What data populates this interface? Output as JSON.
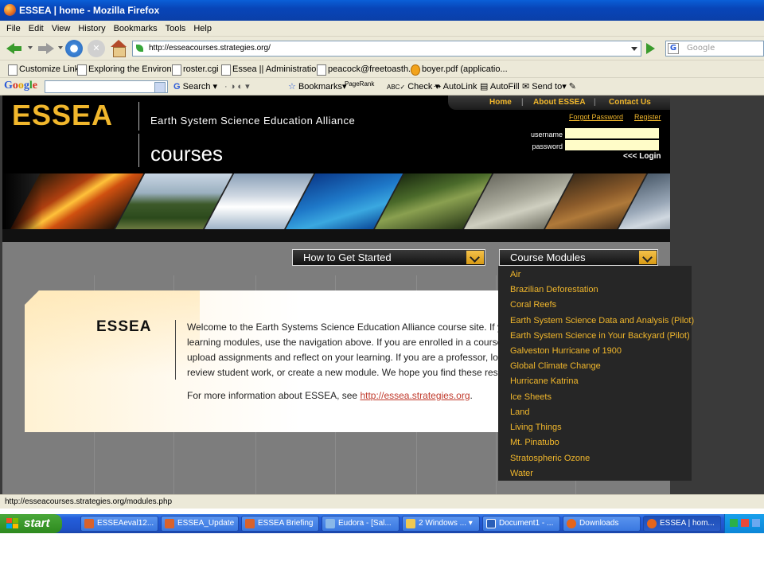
{
  "window": {
    "title": "ESSEA | home - Mozilla Firefox"
  },
  "menu": [
    "File",
    "Edit",
    "View",
    "History",
    "Bookmarks",
    "Tools",
    "Help"
  ],
  "nav": {
    "url": "http://esseacourses.strategies.org/",
    "search_placeholder": "Google",
    "search_engine_icon": "G"
  },
  "bookmarks": [
    "Customize Links",
    "Exploring the Environ...",
    "roster.cgi",
    "Essea || Administratio...",
    "peacock@freetoasth...",
    "boyer.pdf (applicatio..."
  ],
  "google_toolbar": {
    "logo_letters": [
      "G",
      "o",
      "o",
      "g",
      "l",
      "e"
    ],
    "search_label": "Search",
    "bookmarks_label": "Bookmarks",
    "pagerank_label": "PageRank",
    "check_label": "Check",
    "autolink_label": "AutoLink",
    "autofill_label": "AutoFill",
    "sendto_label": "Send to"
  },
  "site": {
    "logo": "ESSEA",
    "subtitle": "Earth System Science Education Alliance",
    "courses": "courses",
    "topnav": [
      "Home",
      "About ESSEA",
      "Contact Us"
    ],
    "topnav_sep": "|",
    "forgot": "Forgot Password",
    "register": "Register",
    "username_label": "username",
    "password_label": "password",
    "login": "<<< Login",
    "get_started": "How to Get Started",
    "course_modules": "Course Modules",
    "welcome_title": "ESSEA",
    "welcome_text": "Welcome to the Earth Systems Science Education Alliance course site. If you wish to browse the learning modules, use the navigation above. If you are enrolled in a course, log into your account to upload assignments and reflect on your learning. If you are a professor, log into access the course, review student work, or create a new module. We hope you find these resources valuable.",
    "more_prefix": "For more information about ESSEA, see ",
    "more_link": "http://essea.strategies.org",
    "more_suffix": "."
  },
  "modules": [
    "Air",
    "Brazilian Deforestation",
    "Coral Reefs",
    "Earth System Science Data and Analysis (Pilot)",
    "Earth System Science in Your Backyard (Pilot)",
    "Galveston Hurricane of 1900",
    "Global Climate Change",
    "Hurricane Katrina",
    "Ice Sheets",
    "Land",
    "Living Things",
    "Mt. Pinatubo",
    "Stratospheric Ozone",
    "Water"
  ],
  "status": "http://esseacourses.strategies.org/modules.php",
  "taskbar": {
    "start": "start",
    "tasks": [
      "ESSEAeval12...",
      "ESSEA_Update",
      "ESSEA Briefing",
      "Eudora - [Sal...",
      "2 Windows ...",
      "Document1 - ...",
      "Downloads",
      "ESSEA | hom..."
    ]
  }
}
